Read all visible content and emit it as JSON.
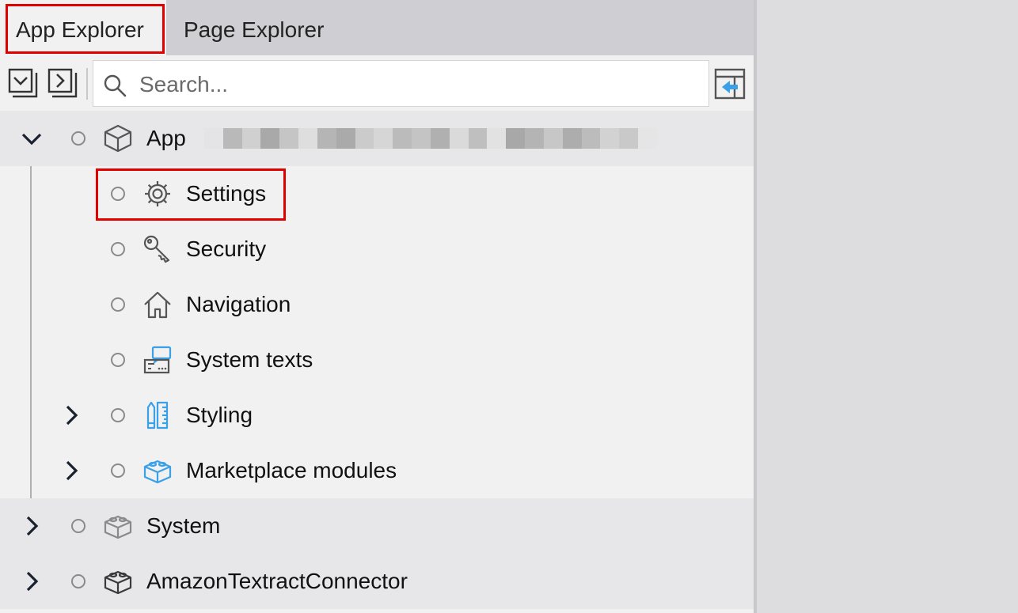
{
  "tabs": [
    {
      "label": "App Explorer",
      "active": true
    },
    {
      "label": "Page Explorer",
      "active": false
    }
  ],
  "toolbar": {
    "collapse_all_icon": "collapse-all-icon",
    "expand_all_icon": "expand-all-icon",
    "search_placeholder": "Search...",
    "search_value": "",
    "sync_icon": "sync-with-editor-icon"
  },
  "tree": {
    "root": {
      "label": "App",
      "icon": "cube-icon",
      "expanded": true
    },
    "children": [
      {
        "label": "Settings",
        "icon": "gear-icon"
      },
      {
        "label": "Security",
        "icon": "key-icon"
      },
      {
        "label": "Navigation",
        "icon": "home-icon"
      },
      {
        "label": "System texts",
        "icon": "system-texts-icon"
      },
      {
        "label": "Styling",
        "icon": "styling-icon",
        "expandable": true
      },
      {
        "label": "Marketplace modules",
        "icon": "marketplace-module-icon",
        "expandable": true
      }
    ],
    "modules": [
      {
        "label": "System",
        "icon": "module-icon",
        "expandable": true
      },
      {
        "label": "AmazonTextractConnector",
        "icon": "module-icon",
        "expandable": true
      }
    ]
  },
  "colors": {
    "highlight_border": "#e00000",
    "accent_blue": "#3aa0e8",
    "icon_gray": "#555555"
  }
}
